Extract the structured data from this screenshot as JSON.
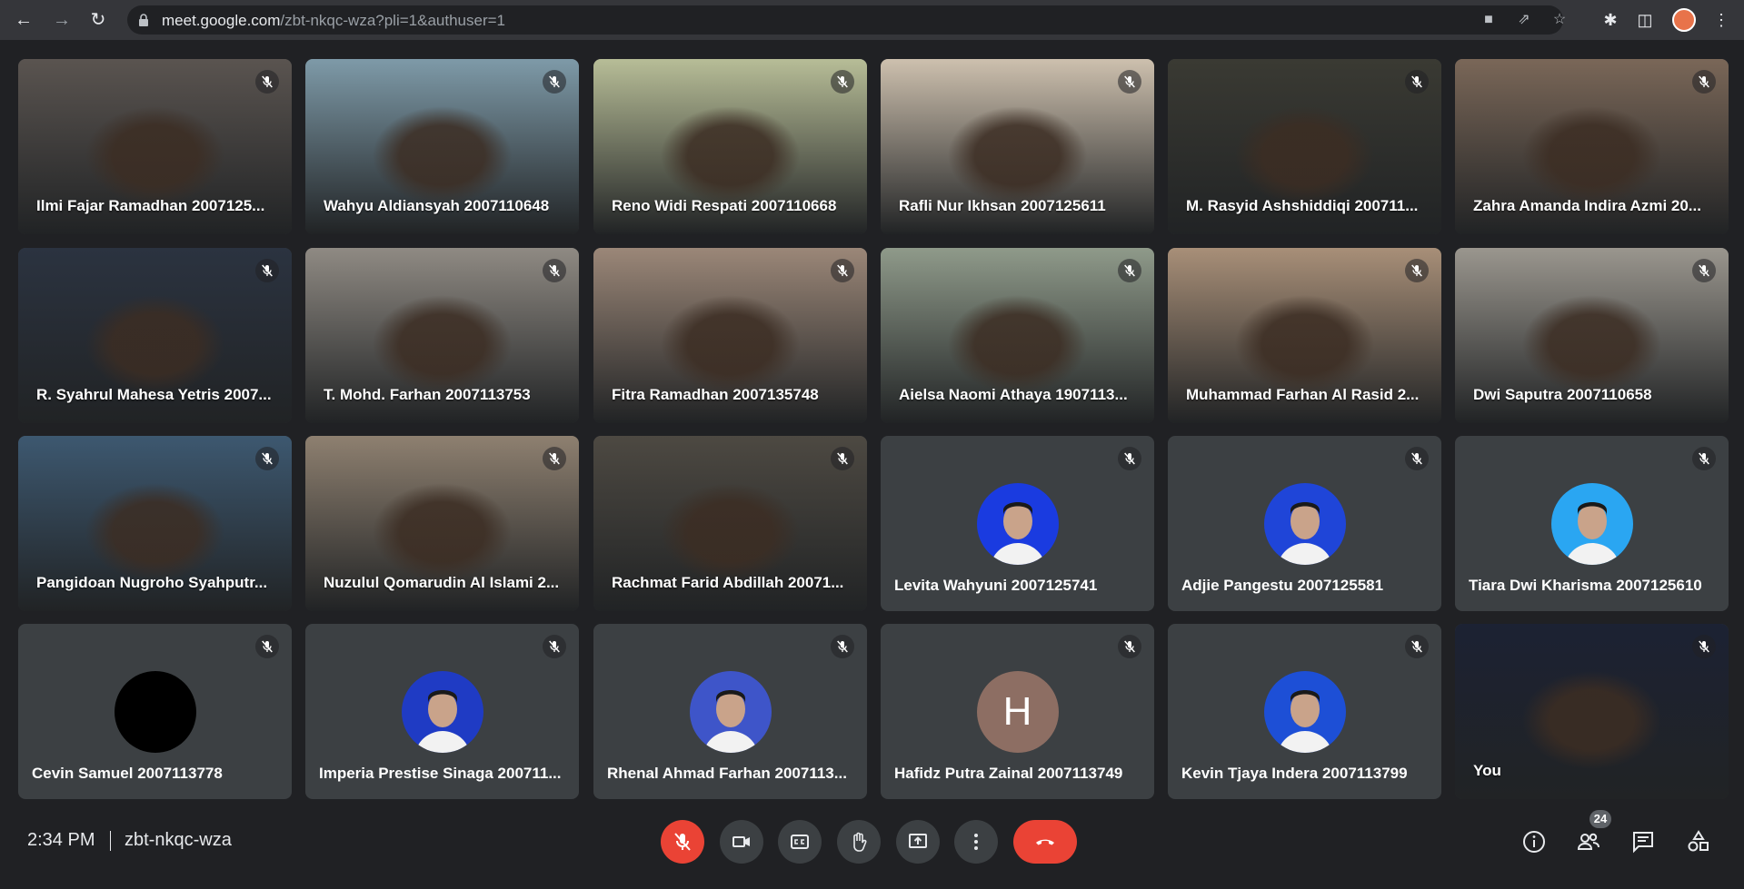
{
  "browser": {
    "url_host": "meet.google.com",
    "url_path": "/zbt-nkqc-wza?pli=1&authuser=1"
  },
  "participants": [
    {
      "name": "Ilmi Fajar Ramadhan 2007125...",
      "type": "video",
      "bg": "#5a5450"
    },
    {
      "name": "Wahyu Aldiansyah 2007110648",
      "type": "video",
      "bg": "#7e9aa8"
    },
    {
      "name": "Reno Widi Respati 2007110668",
      "type": "video",
      "bg": "#b7bd97"
    },
    {
      "name": "Rafli Nur Ikhsan 2007125611",
      "type": "video",
      "bg": "#cdc0ae"
    },
    {
      "name": "M. Rasyid Ashshiddiqi 200711...",
      "type": "video",
      "bg": "#3a3a33"
    },
    {
      "name": "Zahra Amanda Indira Azmi 20...",
      "type": "video",
      "bg": "#7a6758"
    },
    {
      "name": "R. Syahrul Mahesa Yetris 2007...",
      "type": "video",
      "bg": "#2b3340"
    },
    {
      "name": "T. Mohd. Farhan 2007113753",
      "type": "video",
      "bg": "#8f8a83"
    },
    {
      "name": "Fitra Ramadhan 2007135748",
      "type": "video",
      "bg": "#9b8778"
    },
    {
      "name": "Aielsa Naomi Athaya 1907113...",
      "type": "video",
      "bg": "#8f9a8a"
    },
    {
      "name": "Muhammad Farhan Al Rasid 2...",
      "type": "video",
      "bg": "#a88f78"
    },
    {
      "name": "Dwi Saputra 2007110658",
      "type": "video",
      "bg": "#9a968e"
    },
    {
      "name": "Pangidoan Nugroho Syahputr...",
      "type": "video",
      "bg": "#3d5870"
    },
    {
      "name": "Nuzulul Qomarudin Al Islami 2...",
      "type": "video",
      "bg": "#8e8070"
    },
    {
      "name": "Rachmat Farid Abdillah 20071...",
      "type": "video",
      "bg": "#4d4942"
    },
    {
      "name": "Levita Wahyuni 2007125741",
      "type": "avatar",
      "avatar_color": "#1a3be0"
    },
    {
      "name": "Adjie Pangestu 2007125581",
      "type": "avatar",
      "avatar_color": "#1f45d8"
    },
    {
      "name": "Tiara Dwi Kharisma 2007125610",
      "type": "avatar",
      "avatar_color": "#2aa6f2"
    },
    {
      "name": "Cevin Samuel 2007113778",
      "type": "avatar",
      "avatar_color": "#000000"
    },
    {
      "name": "Imperia Prestise Sinaga 200711...",
      "type": "avatar",
      "avatar_color": "#1f3bc4"
    },
    {
      "name": "Rhenal Ahmad Farhan 2007113...",
      "type": "avatar",
      "avatar_color": "#3e55c9"
    },
    {
      "name": "Hafidz Putra Zainal 2007113749",
      "type": "avatar",
      "avatar_color": "#8d6e63",
      "letter": "H"
    },
    {
      "name": "Kevin Tjaya Indera 2007113799",
      "type": "avatar",
      "avatar_color": "#1d4fd6"
    },
    {
      "name": "You",
      "type": "video",
      "bg": "#1c2233"
    }
  ],
  "bottom_bar": {
    "time": "2:34 PM",
    "meeting_code": "zbt-nkqc-wza",
    "participant_count": "24"
  },
  "colors": {
    "accent_red": "#ea4335",
    "bg": "#202124",
    "tile": "#3c4043"
  }
}
